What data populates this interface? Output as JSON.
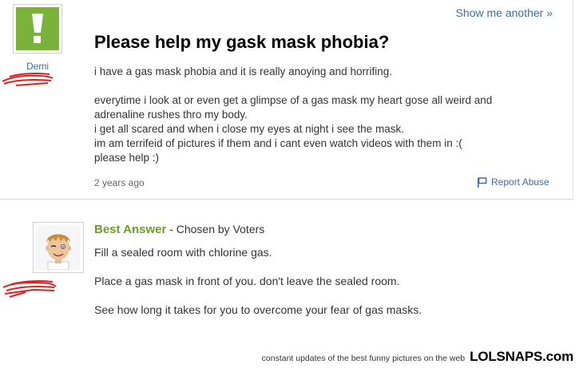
{
  "question": {
    "asker_name": "Demi",
    "show_another": "Show me another »",
    "title": "Please help my gask mask phobia?",
    "body_lines": [
      "i have a gas mask phobia and it is really anoying and horrifing.",
      "everytime i look at or even get a glimpse of a gas mask my heart gose all weird and",
      "adrenaline rushes thro my body.",
      "i get all scared and when i close my eyes at night i see the mask.",
      "im am terrifeid of pictures if them and i cant even watch videos with them in :(",
      "please help :)"
    ],
    "time_ago": "2 years ago",
    "report_abuse": "Report Abuse",
    "colors": {
      "link": "#3b6ea5",
      "avatar_bg": "#7ab33a"
    }
  },
  "best_answer": {
    "label": "Best Answer",
    "chosen_by": " - Chosen by Voters",
    "paragraphs": [
      "Fill a sealed room with chlorine gas.",
      "Place a gas mask in front of you. don't leave the sealed room.",
      "See how long it takes for you to overcome your fear of gas masks."
    ],
    "colors": {
      "label": "#6b9f2a"
    }
  },
  "footer": {
    "text": "constant updates of the best funny pictures on the web",
    "logo": "LOLSNAPS.com"
  }
}
